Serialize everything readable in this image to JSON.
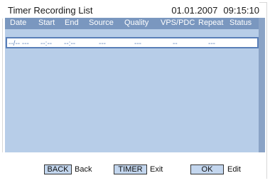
{
  "window": {
    "title": "Timer Recording List",
    "date": "01.01.2007",
    "time": "09:15:10"
  },
  "table": {
    "columns": [
      "Date",
      "Start",
      "End",
      "Source",
      "Quality",
      "VPS/PDC",
      "Repeat",
      "Status"
    ],
    "rows": [
      {
        "date": "--/-- ---",
        "start": "--:--",
        "end": "--:--",
        "source": "---",
        "quality": "---",
        "vps_pdc": "--",
        "repeat": "---",
        "status": ""
      }
    ]
  },
  "footer": {
    "back_key": "BACK",
    "back_label": "Back",
    "timer_key": "TIMER",
    "timer_label": "Exit",
    "ok_key": "OK",
    "ok_label": "Edit"
  },
  "colors": {
    "panel": "#b7cde8",
    "header": "#7a97bf",
    "selection_border": "#5a7fb8"
  }
}
